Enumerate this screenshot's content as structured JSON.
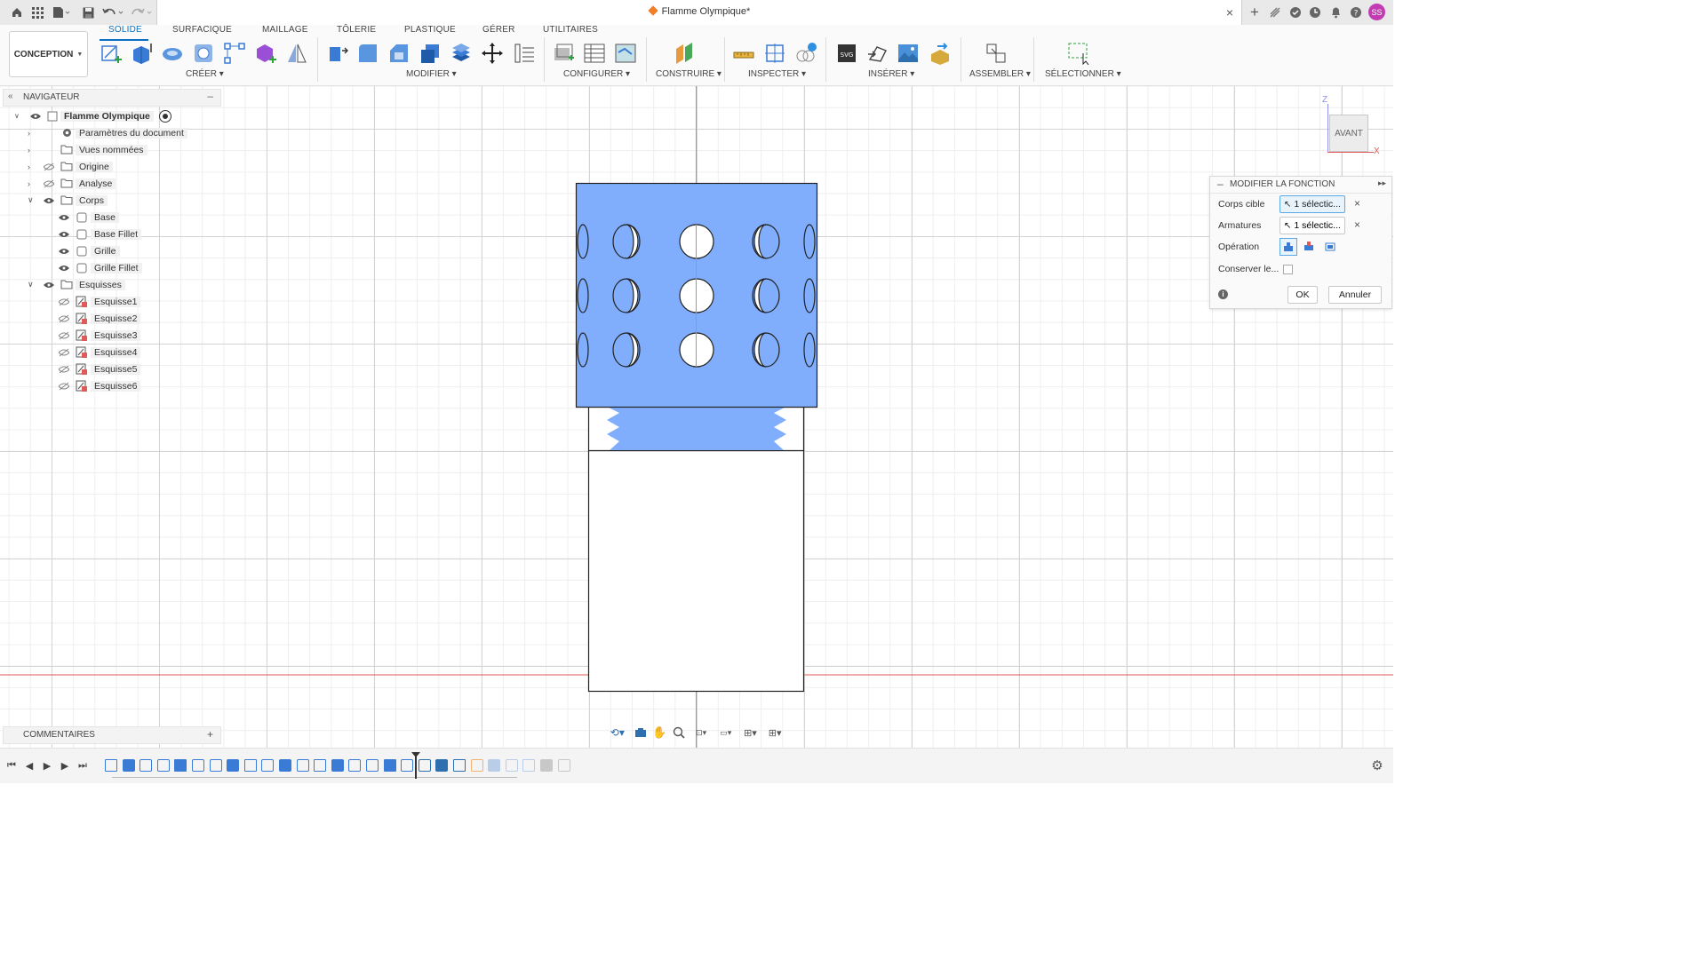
{
  "window": {
    "title": "Flamme Olympique*",
    "user_initials": "SS"
  },
  "workspace": {
    "label": "CONCEPTION"
  },
  "ribbon": {
    "tabs": [
      "SOLIDE",
      "SURFACIQUE",
      "MAILLAGE",
      "TÔLERIE",
      "PLASTIQUE",
      "GÉRER",
      "UTILITAIRES"
    ],
    "active_tab": "SOLIDE",
    "groups": [
      "CRÉER",
      "MODIFIER",
      "CONFIGURER",
      "CONSTRUIRE",
      "INSPECTER",
      "INSÉRER",
      "ASSEMBLER",
      "SÉLECTIONNER"
    ]
  },
  "navigator": {
    "title": "NAVIGATEUR",
    "root": "Flamme Olympique",
    "items": [
      {
        "label": "Paramètres du document",
        "icon": "gear-icon"
      },
      {
        "label": "Vues nommées",
        "icon": "folder-icon"
      },
      {
        "label": "Origine",
        "icon": "folder-icon"
      },
      {
        "label": "Analyse",
        "icon": "folder-icon"
      },
      {
        "label": "Corps",
        "icon": "folder-icon"
      },
      {
        "label": "Base",
        "icon": "body-icon"
      },
      {
        "label": "Base Fillet",
        "icon": "body-icon"
      },
      {
        "label": "Grille",
        "icon": "body-icon"
      },
      {
        "label": "Grille Fillet",
        "icon": "body-icon"
      },
      {
        "label": "Esquisses",
        "icon": "folder-icon"
      },
      {
        "label": "Esquisse1",
        "icon": "sketch-icon"
      },
      {
        "label": "Esquisse2",
        "icon": "sketch-icon"
      },
      {
        "label": "Esquisse3",
        "icon": "sketch-icon"
      },
      {
        "label": "Esquisse4",
        "icon": "sketch-icon"
      },
      {
        "label": "Esquisse5",
        "icon": "sketch-icon"
      },
      {
        "label": "Esquisse6",
        "icon": "sketch-icon"
      }
    ]
  },
  "viewcube": {
    "face": "AVANT",
    "axis_z": "Z",
    "axis_x": "X"
  },
  "feature_panel": {
    "title": "MODIFIER LA FONCTION",
    "target_label": "Corps cible",
    "target_value": "1 sélectic...",
    "tools_label": "Armatures",
    "tools_value": "1 sélectic...",
    "operation_label": "Opération",
    "keep_label": "Conserver le...",
    "ok": "OK",
    "cancel": "Annuler"
  },
  "comments": {
    "title": "COMMENTAIRES"
  },
  "colors": {
    "accent": "#0a6fc2",
    "body_blue": "#80aefc",
    "selection": "#5aa9e6",
    "x_axis": "#e05a5a",
    "z_axis": "#8f8ff0"
  }
}
